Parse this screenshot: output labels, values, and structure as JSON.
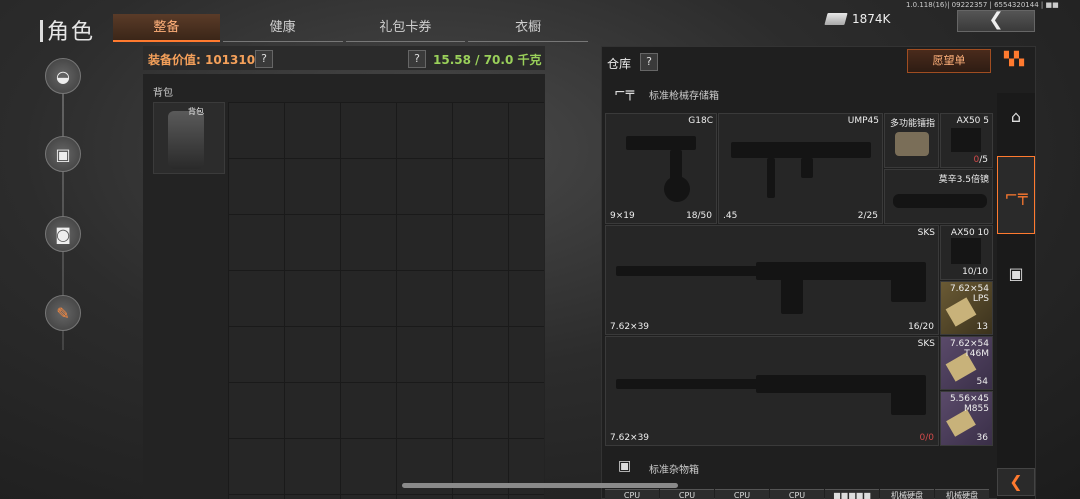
{
  "header": {
    "title": "角色",
    "tabs": [
      "整备",
      "健康",
      "礼包卡券",
      "衣橱"
    ],
    "active_tab": 0,
    "currency": "1874K",
    "version": "1.0.118(16)| 09222357 | 6554320144 | ■■"
  },
  "left_panel": {
    "value_label": "装备价值: 101310",
    "help": "?",
    "weight": "15.58 / 70.0 千克",
    "backpack_title": "背包",
    "backpack_item": "背包"
  },
  "warehouse": {
    "title": "仓库",
    "help": "?",
    "wishlist": "愿望单",
    "section1": "标准枪械存储箱",
    "section2": "标准杂物箱",
    "items": {
      "g18c": {
        "name": "G18C",
        "caliber": "9×19",
        "ammo": "18/50"
      },
      "ump45": {
        "name": "UMP45",
        "caliber": ".45",
        "ammo": "2/25"
      },
      "tool": {
        "name": "多功能镭指"
      },
      "ax50_5": {
        "name": "AX50 5",
        "count_a": "0",
        "count_b": "/5"
      },
      "scope": {
        "name": "莫辛3.5倍镜"
      },
      "sks1": {
        "name": "SKS",
        "caliber": "7.62×39",
        "ammo": "16/20"
      },
      "ax50_10": {
        "name": "AX50 10",
        "count": "10/10"
      },
      "lps": {
        "name": "7.62×54 LPS",
        "count": "13"
      },
      "sks2": {
        "name": "SKS",
        "caliber": "7.62×39",
        "ammo": "0/0"
      },
      "t46m": {
        "name": "7.62×54 T46M",
        "count": "54"
      },
      "m855": {
        "name": "5.56×45 M855",
        "count": "36"
      }
    },
    "sundry": [
      "CPU",
      "CPU",
      "CPU",
      "CPU",
      "■■■■■",
      "机械硬盘",
      "机械硬盘"
    ]
  },
  "colors": {
    "accent": "#ff7a2f",
    "value": "#f4a05a",
    "weight": "#9ad05a",
    "ammo_empty": "#d24a4a"
  }
}
